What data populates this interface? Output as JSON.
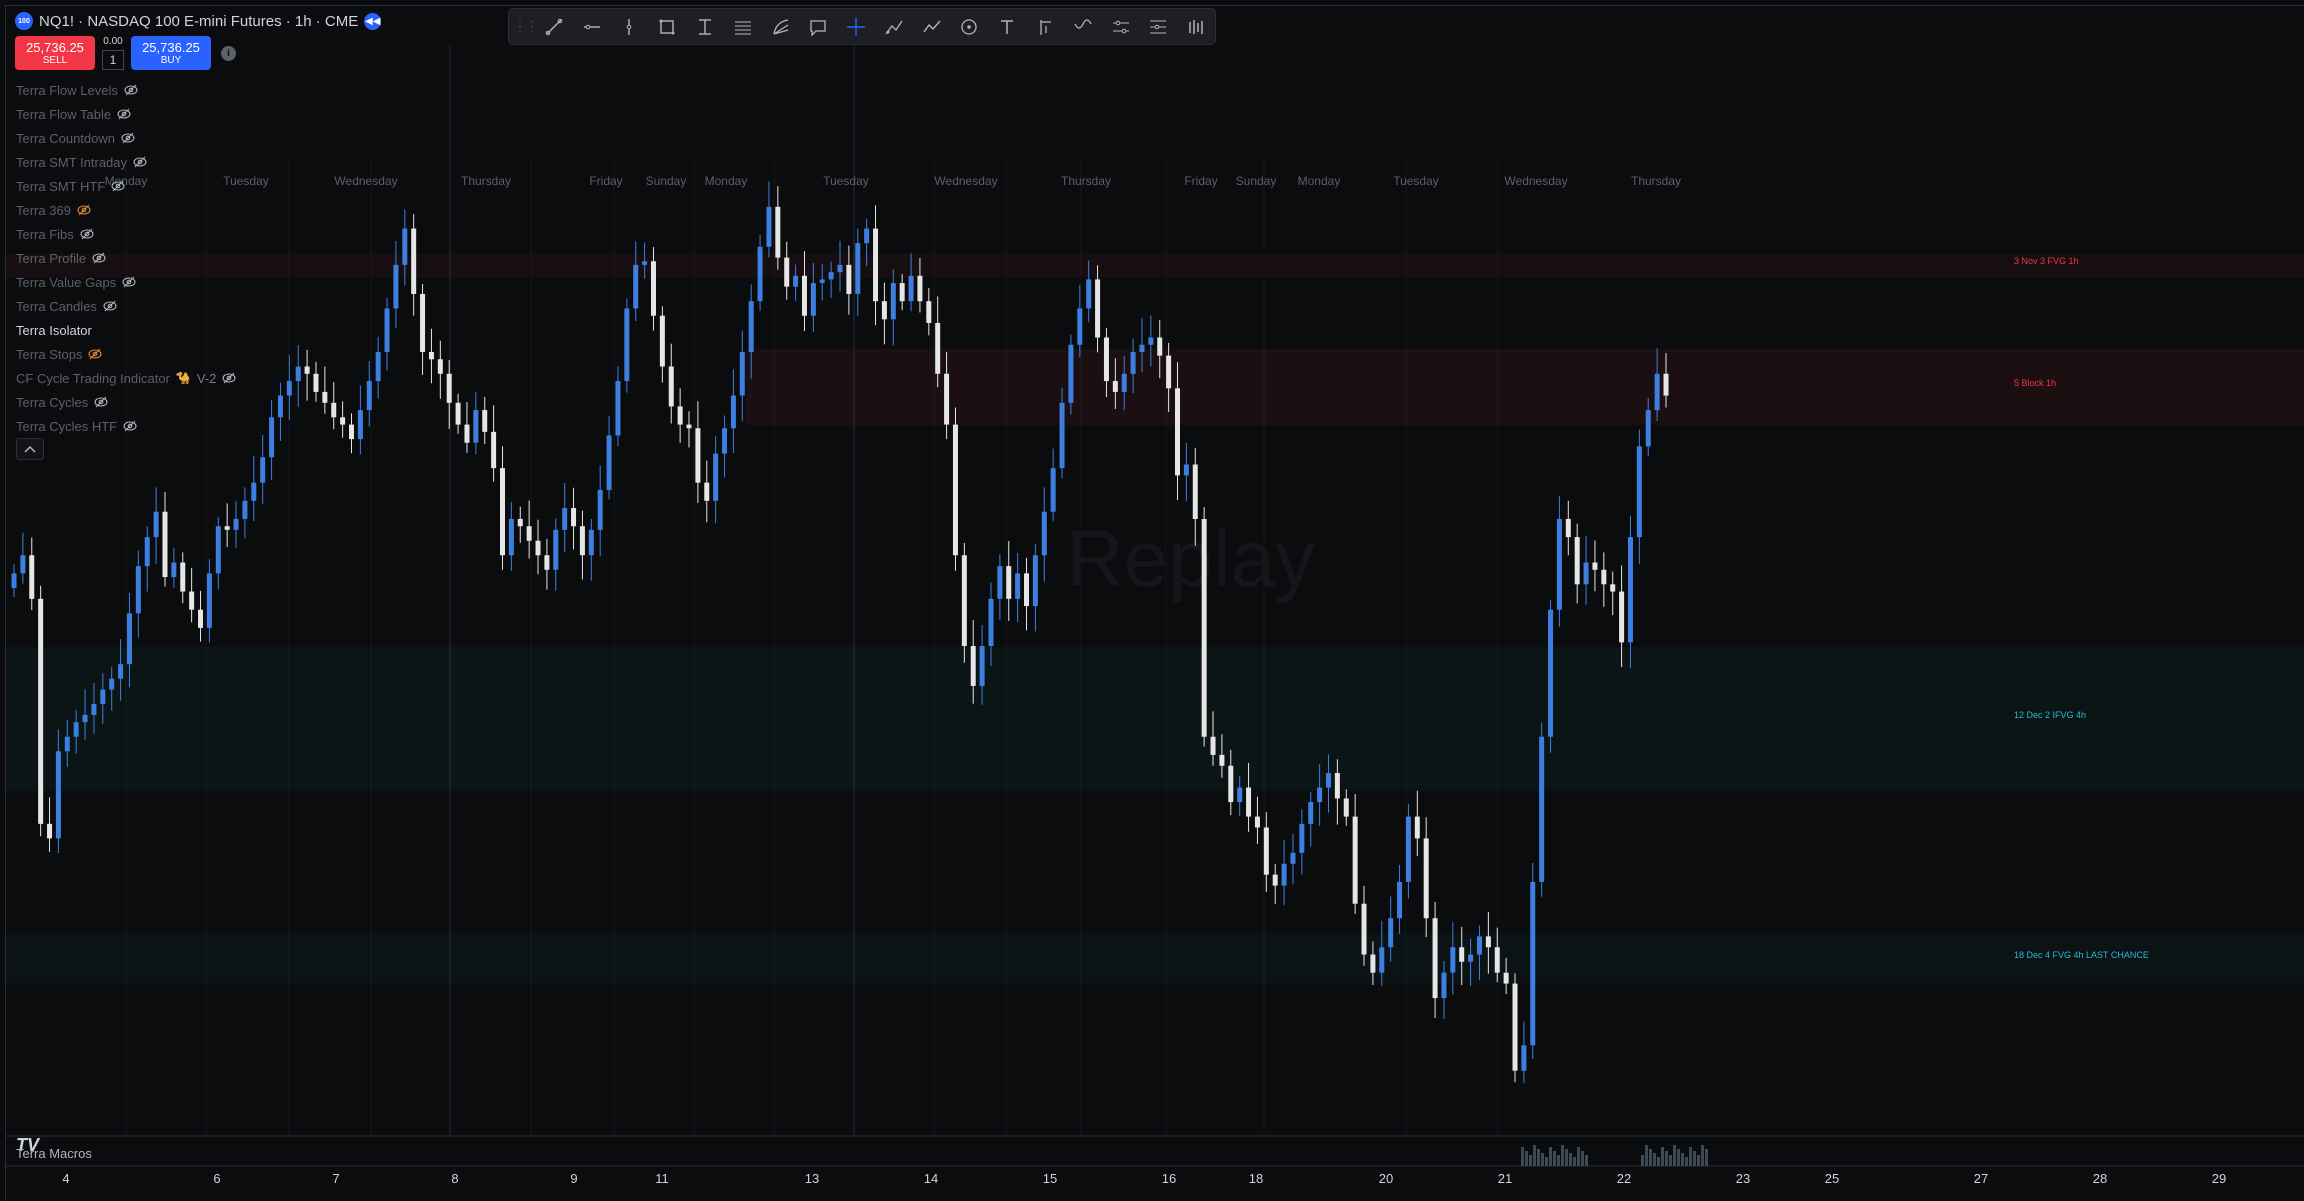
{
  "header": {
    "symbol_logo": "100",
    "title": "NQ1! · NASDAQ 100 E-mini Futures · 1h · CME",
    "replay_icon": "rewind-icon"
  },
  "trade": {
    "sell_price": "25,736.25",
    "sell_label": "SELL",
    "spread": "0.00",
    "quantity": "1",
    "buy_price": "25,736.25",
    "buy_label": "BUY",
    "info_icon": "i"
  },
  "indicators": [
    {
      "label": "Terra Flow Levels",
      "active": false,
      "eye": "hidden"
    },
    {
      "label": "Terra Flow Table",
      "active": false,
      "eye": "hidden"
    },
    {
      "label": "Terra Countdown",
      "active": false,
      "eye": "hidden"
    },
    {
      "label": "Terra SMT Intraday",
      "active": false,
      "eye": "hidden"
    },
    {
      "label": "Terra SMT HTF",
      "active": false,
      "eye": "hidden"
    },
    {
      "label": "Terra 369",
      "active": false,
      "eye": "hidden-warn"
    },
    {
      "label": "Terra Fibs",
      "active": false,
      "eye": "hidden"
    },
    {
      "label": "Terra Profile",
      "active": false,
      "eye": "hidden"
    },
    {
      "label": "Terra Value Gaps",
      "active": false,
      "eye": "hidden"
    },
    {
      "label": "Terra Candles",
      "active": false,
      "eye": "hidden"
    },
    {
      "label": "Terra Isolator",
      "active": true,
      "eye": "none"
    },
    {
      "label": "Terra Stops",
      "active": false,
      "eye": "hidden-warn"
    },
    {
      "label": "CF Cycle Trading Indicator",
      "emoji": "🐪",
      "suffix": "V-2",
      "active": false,
      "eye": "hidden"
    },
    {
      "label": "Terra Cycles",
      "active": false,
      "eye": "hidden"
    },
    {
      "label": "Terra Cycles HTF",
      "active": false,
      "eye": "hidden"
    }
  ],
  "collapse_icon": "chevron-up-icon",
  "toolbar": [
    "trend-line-icon",
    "horizontal-ray-icon",
    "vertical-line-icon",
    "rectangle-icon",
    "price-range-icon",
    "parallel-channel-icon",
    "fib-icon",
    "callout-icon",
    "crosshair-icon",
    "brush-icon",
    "path-icon",
    "circle-icon",
    "text-icon",
    "pitchfork-icon",
    "pattern-icon",
    "long-position-icon",
    "short-position-icon",
    "volume-bars-icon"
  ],
  "watermark": "Replay",
  "colors": {
    "up_candle": "#3d7fe0",
    "down_candle": "#e6e6e6",
    "bearish_zone": "#f23645",
    "bullish_zone": "#26a69a",
    "zone_label_red": "#f23645",
    "zone_label_teal": "#2ab8d8",
    "axis_text": "#d1d4dc"
  },
  "chart_data": {
    "type": "candlestick",
    "series_style": "ohlc-candles",
    "day_labels": [
      "Monday",
      "Tuesday",
      "Wednesday",
      "Thursday",
      "Friday",
      "Sunday",
      "Monday",
      "Tuesday",
      "Wednesday",
      "Thursday",
      "Friday",
      "Sunday",
      "Monday",
      "Tuesday",
      "Wednesday",
      "Thursday"
    ],
    "date_ticks": [
      "4",
      "6",
      "7",
      "8",
      "9",
      "11",
      "13",
      "14",
      "15",
      "16",
      "18",
      "20",
      "21",
      "22",
      "23",
      "25",
      "27",
      "28",
      "29"
    ],
    "zones": [
      {
        "label": "3 Nov 3 FVG 1h",
        "bias": "bearish"
      },
      {
        "label": "5 Block 1h",
        "bias": "bearish"
      },
      {
        "label": "12 Dec 2 IFVG 4h",
        "bias": "bullish"
      },
      {
        "label": "18 Dec 4 FVG 4h LAST CHANCE",
        "bias": "bullish"
      }
    ],
    "closes": [
      25150,
      25200,
      25080,
      24460,
      24420,
      24660,
      24700,
      24740,
      24760,
      24790,
      24830,
      24860,
      24900,
      25040,
      25170,
      25250,
      25320,
      25140,
      25180,
      25100,
      25050,
      25000,
      25150,
      25280,
      25270,
      25300,
      25350,
      25400,
      25470,
      25580,
      25640,
      25680,
      25720,
      25700,
      25650,
      25620,
      25580,
      25560,
      25520,
      25600,
      25680,
      25760,
      25880,
      26000,
      26100,
      25920,
      25760,
      25740,
      25700,
      25620,
      25560,
      25510,
      25600,
      25540,
      25440,
      25200,
      25300,
      25280,
      25240,
      25200,
      25160,
      25270,
      25330,
      25280,
      25200,
      25270,
      25380,
      25530,
      25680,
      25880,
      26000,
      26010,
      25860,
      25720,
      25610,
      25560,
      25550,
      25400,
      25350,
      25480,
      25550,
      25640,
      25760,
      25900,
      26050,
      26160,
      26020,
      25940,
      25970,
      25860,
      25950,
      25960,
      25980,
      26000,
      25920,
      26060,
      26100,
      25900,
      25850,
      25950,
      25900,
      25970,
      25900,
      25840,
      25700,
      25560,
      25200,
      24950,
      24840,
      24950,
      25080,
      25170,
      25080,
      25150,
      25060,
      25200,
      25320,
      25440,
      25620,
      25780,
      25880,
      25960,
      25800,
      25680,
      25650,
      25700,
      25760,
      25780,
      25800,
      25750,
      25660,
      25420,
      25450,
      25300,
      24700,
      24650,
      24620,
      24520,
      24560,
      24480,
      24450,
      24320,
      24290,
      24350,
      24380,
      24460,
      24520,
      24560,
      24600,
      24530,
      24480,
      24240,
      24100,
      24050,
      24120,
      24200,
      24300,
      24480,
      24420,
      24200,
      23980,
      24050,
      24120,
      24080,
      24100,
      24150,
      24120,
      24050,
      24020,
      23780,
      23850,
      24300,
      24700,
      25050,
      25300,
      25250,
      25120,
      25180,
      25160,
      25120,
      25100,
      24960,
      25250,
      25500,
      25600,
      25700,
      25640
    ]
  }
}
